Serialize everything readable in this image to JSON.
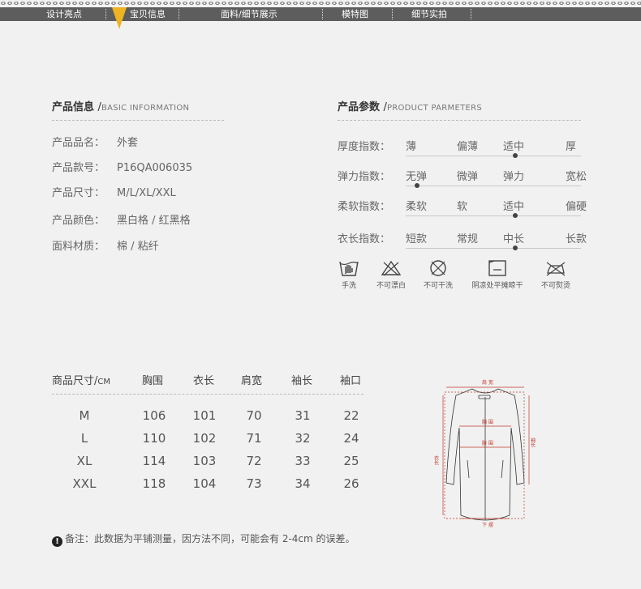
{
  "nav": {
    "items": [
      "设计亮点",
      "宝贝信息",
      "面料/细节展示",
      "模特图",
      "细节实拍"
    ],
    "active_index": 1,
    "pointer_color": "#f0b321"
  },
  "basic_info": {
    "title": "产品信息",
    "subtitle": "BASIC INFORMATION",
    "rows": [
      {
        "label": "产品品名：",
        "value": "外套"
      },
      {
        "label": "产品款号：",
        "value": "P16QA006035"
      },
      {
        "label": "产品尺寸：",
        "value": "M/L/XL/XXL"
      },
      {
        "label": "产品颜色：",
        "value": "黑白格 / 红黑格"
      },
      {
        "label": "面料材质：",
        "value": "棉 / 粘纤"
      }
    ]
  },
  "parameters": {
    "title": "产品参数",
    "subtitle": "PRODUCT PARMETERS",
    "rows": [
      {
        "label": "厚度指数：",
        "options": [
          "薄",
          "偏薄",
          "适中",
          "厚"
        ],
        "selected": 2
      },
      {
        "label": "弹力指数：",
        "options": [
          "无弹",
          "微弹",
          "弹力",
          "宽松"
        ],
        "selected": 0
      },
      {
        "label": "柔软指数：",
        "options": [
          "柔软",
          "软",
          "适中",
          "偏硬"
        ],
        "selected": 2
      },
      {
        "label": "衣长指数：",
        "options": [
          "短款",
          "常规",
          "中长",
          "长款"
        ],
        "selected": 2
      }
    ]
  },
  "care": [
    {
      "icon": "hand-wash-icon",
      "label": "手洗"
    },
    {
      "icon": "no-bleach-icon",
      "label": "不可漂白"
    },
    {
      "icon": "no-tumble-dry-icon",
      "label": "不可干洗"
    },
    {
      "icon": "shade-flat-dry-icon",
      "label": "阴凉处平摊晾干"
    },
    {
      "icon": "no-iron-icon",
      "label": "不可熨烫"
    }
  ],
  "size_table": {
    "headers": [
      "商品尺寸",
      "胸围",
      "衣长",
      "肩宽",
      "袖长",
      "袖口"
    ],
    "unit": "CM",
    "rows": [
      [
        "M",
        "106",
        "101",
        "70",
        "31",
        "22"
      ],
      [
        "L",
        "110",
        "102",
        "71",
        "32",
        "24"
      ],
      [
        "XL",
        "114",
        "103",
        "72",
        "33",
        "25"
      ],
      [
        "XXL",
        "118",
        "104",
        "73",
        "34",
        "26"
      ]
    ]
  },
  "note": "备注：此数据为平铺测量，因方法不同，可能会有 2-4cm 的误差。",
  "diagram_labels": {
    "shoulder": "肩 宽",
    "chest": "胸 围",
    "waist": "腰 围",
    "hem": "下 摆",
    "length": "衣长",
    "sleeve": "袖长"
  },
  "colors": {
    "accent": "#f0b321",
    "nav_bg": "#5d5d5d",
    "measure": "#c0392b"
  }
}
